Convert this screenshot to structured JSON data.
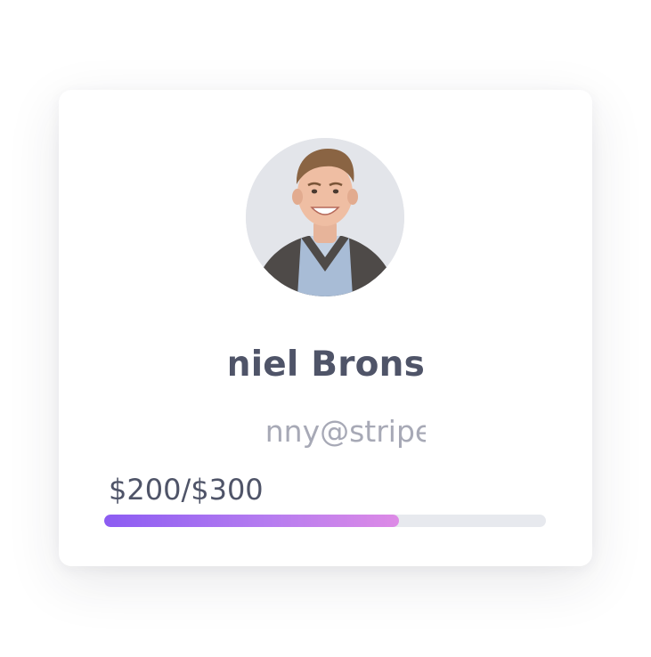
{
  "profile": {
    "name": "niel Brons",
    "email": "nny@stripe.cc",
    "avatar_icon": "person-photo-icon"
  },
  "funding": {
    "amount_text": "$200/$300",
    "raised": 200,
    "goal": 300,
    "progress_fraction": 0.667
  },
  "colors": {
    "progress_start": "#8c5cf2",
    "progress_end": "#dd8ae6",
    "track": "#e7e9ee",
    "name_text": "#4f5468",
    "email_text": "#a7a9b6"
  }
}
